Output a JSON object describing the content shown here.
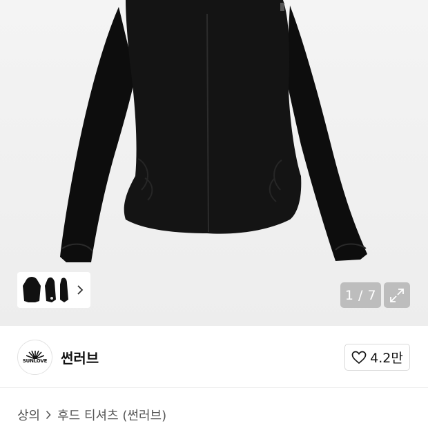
{
  "gallery": {
    "counter": "1 / 7",
    "thumbnails": [
      "hoodie-front-thumb",
      "hoodie-side-thumb",
      "hoodie-back-thumb"
    ],
    "next_icon": "chevron-right-icon",
    "expand_icon": "expand-icon"
  },
  "brand": {
    "logo_text": "SUNLOVE",
    "name": "썬러브"
  },
  "like": {
    "icon": "heart-icon",
    "count": "4.2만"
  },
  "breadcrumb": {
    "category": "상의",
    "subcategory": "후드 티셔츠 (썬러브)"
  },
  "colors": {
    "image_bg": "#efefef",
    "overlay_button": "#969696"
  }
}
